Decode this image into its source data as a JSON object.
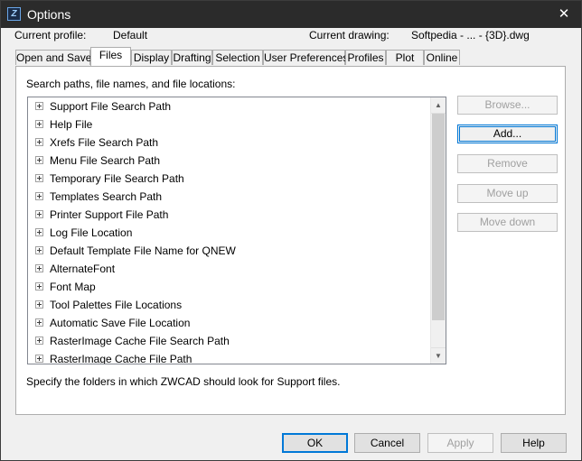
{
  "window": {
    "title": "Options",
    "close_glyph": "✕",
    "icon": "zwcad-app-icon"
  },
  "info": {
    "profile_label": "Current profile:",
    "profile_value": "Default",
    "drawing_label": "Current drawing:",
    "drawing_value": "Softpedia - ... - {3D}.dwg"
  },
  "tabs": [
    {
      "label": "Open and Save",
      "active": false
    },
    {
      "label": "Files",
      "active": true
    },
    {
      "label": "Display",
      "active": false
    },
    {
      "label": "Drafting",
      "active": false
    },
    {
      "label": "Selection",
      "active": false
    },
    {
      "label": "User Preferences",
      "active": false
    },
    {
      "label": "Profiles",
      "active": false
    },
    {
      "label": "Plot",
      "active": false
    },
    {
      "label": "Online",
      "active": false
    }
  ],
  "files": {
    "caption": "Search paths, file names, and file locations:",
    "items": [
      "Support File Search Path",
      "Help File",
      "Xrefs File Search Path",
      "Menu File Search Path",
      "Temporary File Search Path",
      "Templates Search Path",
      "Printer Support File Path",
      "Log File Location",
      "Default Template File Name for QNEW",
      "AlternateFont",
      "Font Map",
      "Tool Palettes File Locations",
      "Automatic Save File Location",
      "RasterImage Cache File Search Path",
      "RasterImage Cache File Path"
    ],
    "buttons": {
      "browse": "Browse...",
      "add": "Add...",
      "remove": "Remove",
      "move_up": "Move up",
      "move_down": "Move down"
    },
    "hint": "Specify the folders in which ZWCAD should look for Support files.",
    "scroll_up_glyph": "▲",
    "scroll_down_glyph": "▼"
  },
  "footer": {
    "ok": "OK",
    "cancel": "Cancel",
    "apply": "Apply",
    "help": "Help"
  }
}
